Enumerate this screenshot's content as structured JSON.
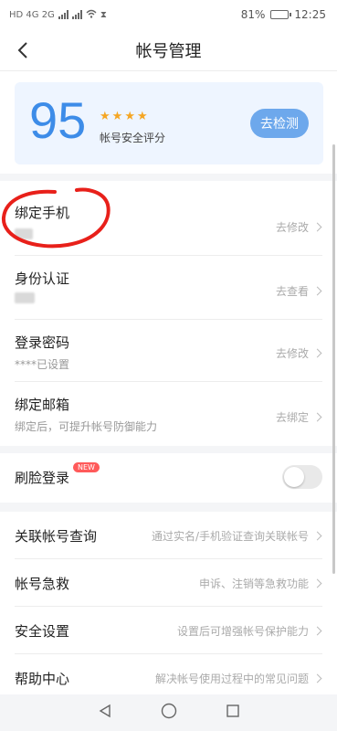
{
  "status_bar": {
    "left_text": "HD 4G 2G",
    "battery_percent": "81%",
    "time": "12:25",
    "battery_level": 0.81
  },
  "nav": {
    "title": "帐号管理",
    "back_icon": "chevron-left-icon"
  },
  "score": {
    "value": "95",
    "stars": 4,
    "label": "帐号安全评分",
    "button": "去检测",
    "accent": "#3d8ce8"
  },
  "accounts": {
    "phone": {
      "title": "绑定手机",
      "action": "去修改"
    },
    "identity": {
      "title": "身份认证",
      "action": "去查看"
    },
    "password": {
      "title": "登录密码",
      "sub": "****已设置",
      "action": "去修改"
    },
    "email": {
      "title": "绑定邮箱",
      "sub": "绑定后，可提升帐号防御能力",
      "action": "去绑定"
    }
  },
  "face_login": {
    "title": "刷脸登录",
    "badge": "NEW",
    "enabled": false
  },
  "tools": [
    {
      "title": "关联帐号查询",
      "desc": "通过实名/手机验证查询关联帐号"
    },
    {
      "title": "帐号急救",
      "desc": "申诉、注销等急救功能"
    },
    {
      "title": "安全设置",
      "desc": "设置后可增强帐号保护能力"
    },
    {
      "title": "帮助中心",
      "desc": "解决帐号使用过程中的常见问题"
    }
  ],
  "colors": {
    "annotation": "#e8201a",
    "badge": "#ff5a5a"
  }
}
